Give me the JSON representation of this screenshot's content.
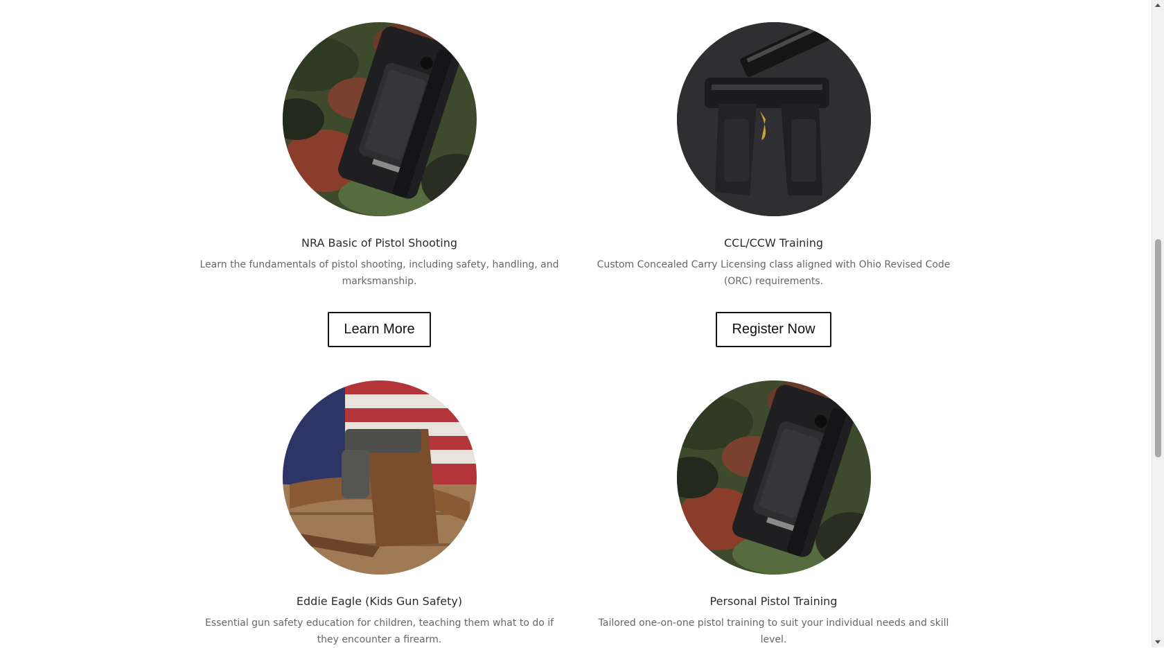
{
  "cards": [
    {
      "image_alt": "pistol-on-camo-image",
      "title": "NRA Basic of Pistol Shooting",
      "description": "Learn the fundamentals of pistol shooting, including safety, handling, and marksmanship.",
      "button_label": "Learn More"
    },
    {
      "image_alt": "pistols-on-dark-surface-image",
      "title": "CCL/CCW Training",
      "description": "Custom Concealed Carry Licensing class aligned with Ohio Revised Code (ORC) requirements.",
      "button_label": "Register Now"
    },
    {
      "image_alt": "holster-and-flag-image",
      "title": "Eddie Eagle (Kids Gun Safety)",
      "description": "Essential gun safety education for children, teaching them what to do if they encounter a firearm."
    },
    {
      "image_alt": "pistol-on-camo-image",
      "title": "Personal Pistol Training",
      "description": "Tailored one-on-one pistol training to suit your individual needs and skill level."
    }
  ],
  "colors": {
    "button_border": "#111111",
    "text_title": "#2b2b2b",
    "text_body": "#666666"
  }
}
